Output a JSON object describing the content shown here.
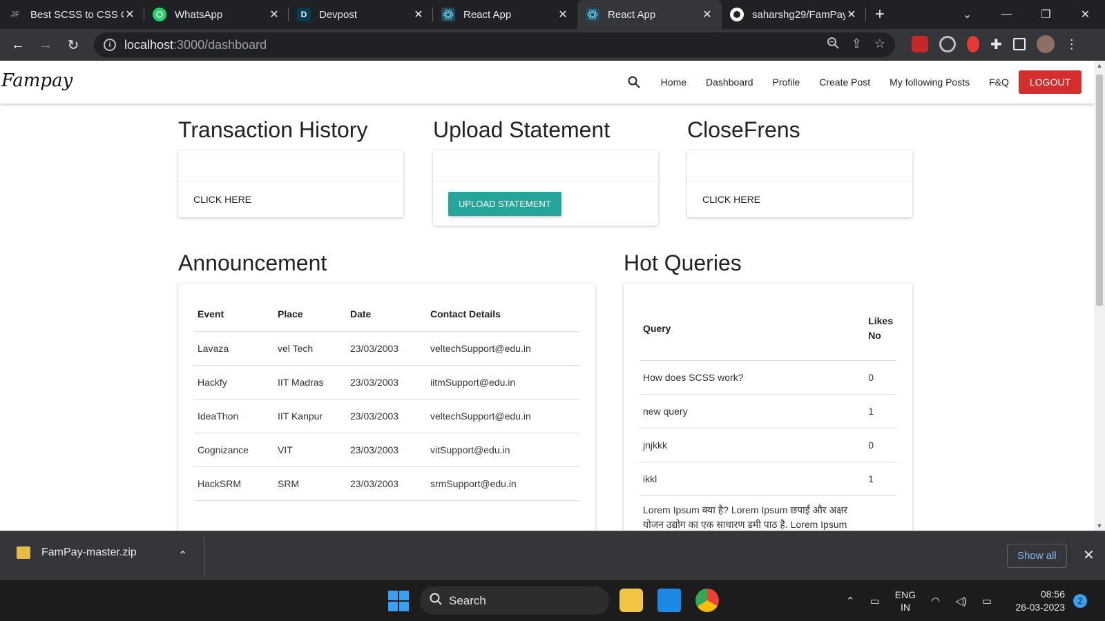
{
  "browser": {
    "tabs": [
      {
        "title": "Best SCSS to CSS C",
        "icon": "jsonformatter-icon"
      },
      {
        "title": "WhatsApp",
        "icon": "whatsapp-icon"
      },
      {
        "title": "Devpost",
        "icon": "devpost-icon",
        "icon_text": "D"
      },
      {
        "title": "React App",
        "icon": "react-icon"
      },
      {
        "title": "React App",
        "icon": "react-icon"
      },
      {
        "title": "saharshg29/FamPay",
        "icon": "github-icon"
      }
    ],
    "url_host": "localhost",
    "url_path": ":3000/dashboard"
  },
  "app": {
    "logo": "Fampay",
    "nav": [
      "Home",
      "Dashboard",
      "Profile",
      "Create Post",
      "My following Posts",
      "F&Q"
    ],
    "logout": "LOGOUT"
  },
  "sections": {
    "transaction": {
      "title": "Transaction History",
      "action": "CLICK HERE"
    },
    "upload": {
      "title": "Upload Statement",
      "action": "UPLOAD STATEMENT"
    },
    "closefrens": {
      "title": "CloseFrens",
      "action": "CLICK HERE"
    },
    "announcement": {
      "title": "Announcement",
      "columns": [
        "Event",
        "Place",
        "Date",
        "Contact Details"
      ],
      "rows": [
        [
          "Lavaza",
          "vel Tech",
          "23/03/2003",
          "veltechSupport@edu.in"
        ],
        [
          "Hackfy",
          "IIT Madras",
          "23/03/2003",
          "iitmSupport@edu.in"
        ],
        [
          "IdeaThon",
          "IIT Kanpur",
          "23/03/2003",
          "veltechSupport@edu.in"
        ],
        [
          "Cognizance",
          "VIT",
          "23/03/2003",
          "vitSupport@edu.in"
        ],
        [
          "HackSRM",
          "SRM",
          "23/03/2003",
          "srmSupport@edu.in"
        ]
      ]
    },
    "hot_queries": {
      "title": "Hot Queries",
      "col_query": "Query",
      "col_likes_1": "Likes",
      "col_likes_2": "No",
      "rows": [
        [
          "How does SCSS work?",
          "0"
        ],
        [
          "new query",
          "1"
        ],
        [
          "jnjkkk",
          "0"
        ],
        [
          "ikkl",
          "1"
        ]
      ],
      "lorem": "Lorem Ipsum क्या है? Lorem Ipsum छपाई और अक्षर योजन उद्योग का एक साधारण डमी पाठ है. Lorem Ipsum"
    }
  },
  "downloads": {
    "file": "FamPay-master.zip",
    "show_all": "Show all"
  },
  "taskbar": {
    "search": "Search",
    "lang_1": "ENG",
    "lang_2": "IN",
    "time": "08:56",
    "date": "26-03-2023",
    "notifications": "2"
  },
  "colors": {
    "logout": "#d32f2f",
    "upload_button": "#26a69a"
  }
}
